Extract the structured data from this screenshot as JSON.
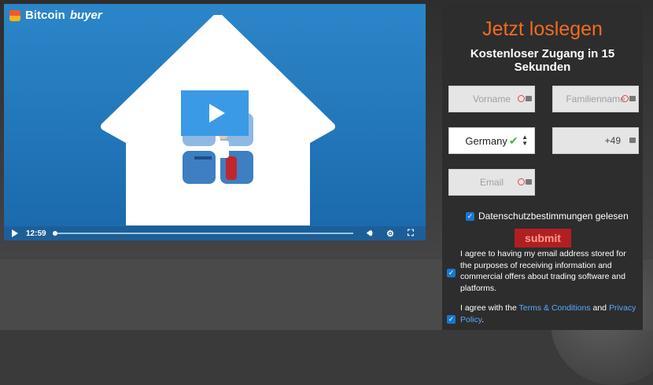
{
  "video": {
    "brand_name": "Bitcoin",
    "brand_suffix": "buyer",
    "time": "12:59",
    "progress": 0.0
  },
  "form": {
    "title": "Jetzt loslegen",
    "subtitle": "Kostenloser Zugang in 15 Sekunden",
    "first_name_placeholder": "Vorname",
    "last_name_placeholder": "Familienname",
    "country": "Germany",
    "phone_prefix": "+49",
    "email_placeholder": "Email",
    "privacy_label": "Datenschutzbestimmungen gelesen",
    "submit_label": "submit",
    "agree1": "I agree to having my email address stored for the purposes of receiving information and commercial offers about trading software and platforms.",
    "agree2_prefix": "I agree with the ",
    "terms_link": "Terms & Conditions",
    "agree2_and": " and ",
    "privacy_link": "Privacy Policy",
    "agree2_suffix": "."
  },
  "colors": {
    "accent_orange": "#f16b21",
    "submit_red": "#b01f23",
    "video_blue": "#1f6fb2",
    "checkbox_blue": "#1976d2",
    "link_blue": "#5aa9ff"
  }
}
